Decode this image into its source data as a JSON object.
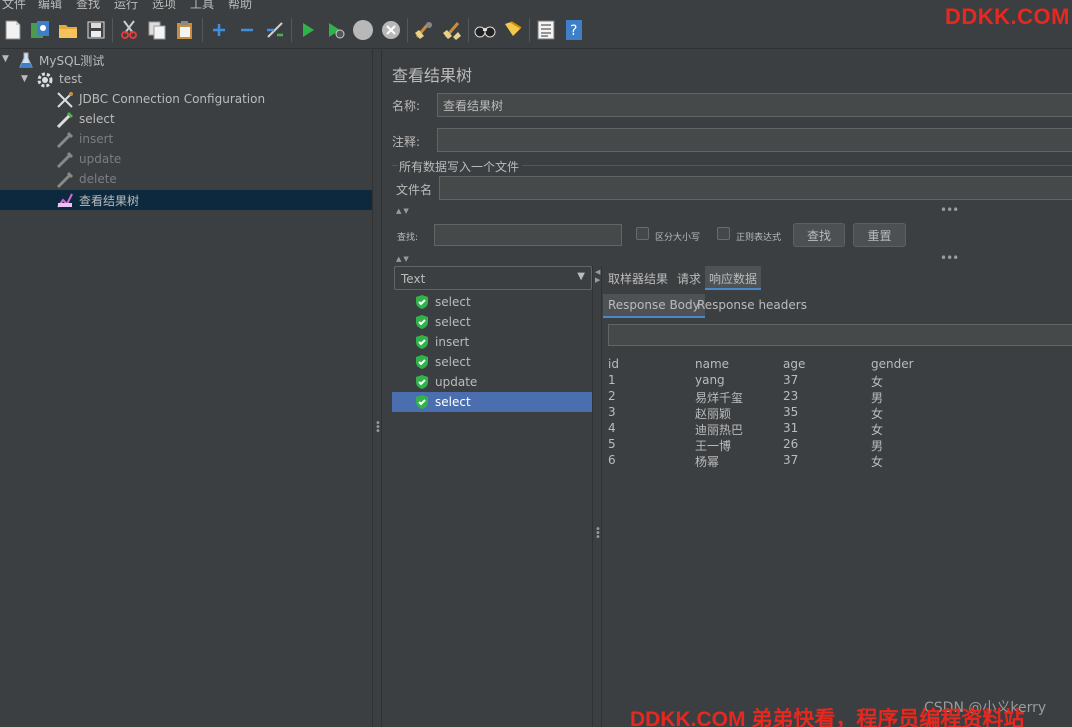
{
  "menu": [
    "文件",
    "编辑",
    "查找",
    "运行",
    "选项",
    "工具",
    "帮助"
  ],
  "watermark_top": "DDKK.COM",
  "watermark_bottom": "DDKK.COM 弟弟快看，程序员编程资料站",
  "csdn_mark": "CSDN @小义kerry",
  "toolbar_icons": [
    "new-icon",
    "templates-icon",
    "open-icon",
    "save-icon",
    "cut-icon",
    "copy-icon",
    "paste-icon",
    "expand-icon",
    "collapse-icon",
    "toggle-icon",
    "start-icon",
    "start-no-pause-icon",
    "stop-icon",
    "shutdown-icon",
    "clear-icon",
    "clear-all-icon",
    "search-icon",
    "reset-search-icon",
    "function-helper-icon",
    "help-icon"
  ],
  "tree": {
    "plan": "MySQL测试",
    "thread_group": "test",
    "items": [
      {
        "label": "JDBC Connection Configuration",
        "icon": "config-icon",
        "enabled": true
      },
      {
        "label": "select",
        "icon": "sampler-icon",
        "enabled": true
      },
      {
        "label": "insert",
        "icon": "sampler-icon",
        "enabled": false
      },
      {
        "label": "update",
        "icon": "sampler-icon",
        "enabled": false
      },
      {
        "label": "delete",
        "icon": "sampler-icon",
        "enabled": false
      },
      {
        "label": "查看结果树",
        "icon": "listener-icon",
        "enabled": true,
        "selected": true
      }
    ]
  },
  "panel": {
    "title": "查看结果树",
    "name_label": "名称:",
    "name_value": "查看结果树",
    "comment_label": "注释:",
    "comment_value": "",
    "file_group_label": "所有数据写入一个文件",
    "filename_label": "文件名",
    "filename_value": "",
    "search_label": "查找:",
    "search_value": "",
    "case_sensitive_label": "区分大小写",
    "regex_label": "正则表达式",
    "find_button": "查找",
    "reset_button": "重置"
  },
  "renderer": {
    "selected": "Text"
  },
  "results": [
    {
      "label": "select",
      "status": "success"
    },
    {
      "label": "select",
      "status": "success"
    },
    {
      "label": "insert",
      "status": "success"
    },
    {
      "label": "select",
      "status": "success"
    },
    {
      "label": "update",
      "status": "success"
    },
    {
      "label": "select",
      "status": "success",
      "selected": true
    }
  ],
  "detail_tabs": [
    "取样器结果",
    "请求",
    "响应数据"
  ],
  "active_detail_tab": "响应数据",
  "response_tabs": [
    "Response Body",
    "Response headers"
  ],
  "active_response_tab": "Response Body",
  "response_table": {
    "columns": [
      "id",
      "name",
      "age",
      "gender"
    ],
    "rows": [
      [
        "1",
        "yang",
        "37",
        "女"
      ],
      [
        "2",
        "易烊千玺",
        "23",
        "男"
      ],
      [
        "3",
        "赵丽颖",
        "35",
        "女"
      ],
      [
        "4",
        "迪丽热巴",
        "31",
        "女"
      ],
      [
        "5",
        "王一博",
        "26",
        "男"
      ],
      [
        "6",
        "杨幂",
        "37",
        "女"
      ]
    ]
  },
  "colors": {
    "background": "#3c3f41",
    "selection": "#4b6eaf",
    "tree_selection": "#0d293e",
    "watermark": "#e8271f",
    "success": "#2fb34a"
  }
}
